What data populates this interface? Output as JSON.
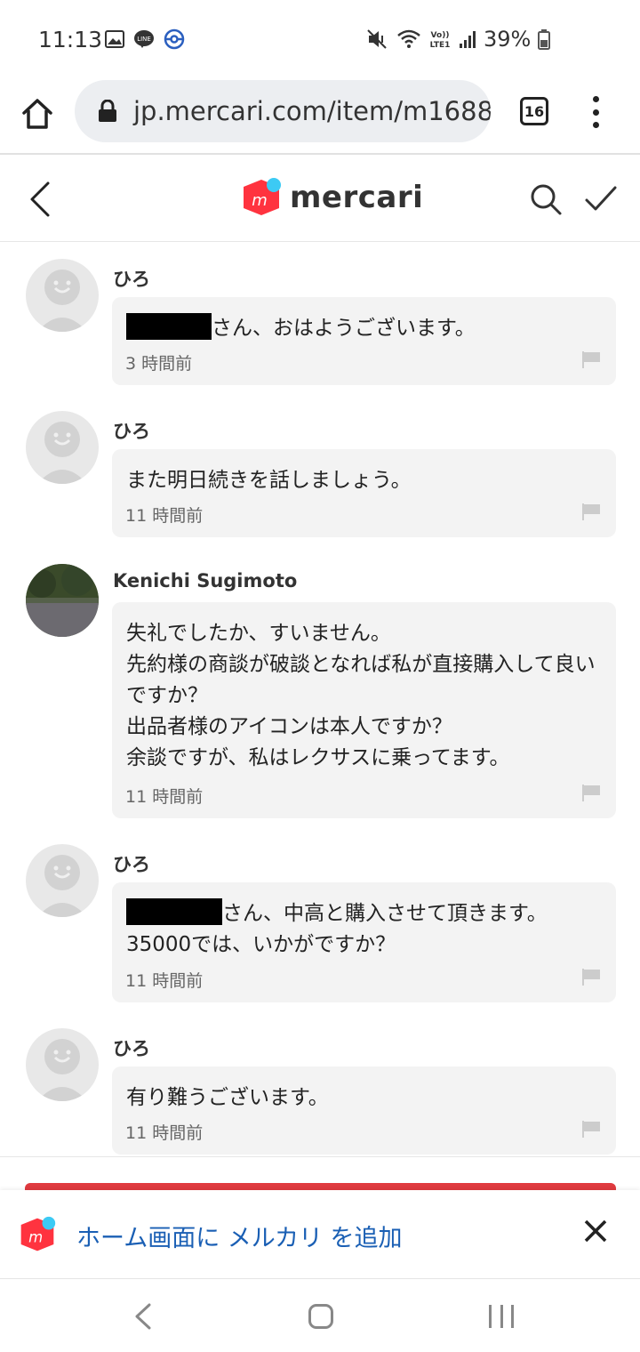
{
  "status_bar": {
    "time": "11:13",
    "battery": "39%",
    "icons": [
      "gallery-icon",
      "line-icon",
      "pokemon-icon",
      "mute-icon",
      "wifi-icon",
      "volte-icon",
      "signal-icon",
      "battery-icon"
    ]
  },
  "browser": {
    "url": "jp.mercari.com/item/m1688",
    "tab_count": "16"
  },
  "header": {
    "brand": "mercari",
    "brand_color": "#ff333f",
    "dot_color": "#3ccaf4"
  },
  "comments": [
    {
      "author": "ひろ",
      "redacted": true,
      "text": "さん、おはようございます。",
      "time": "3 時間前"
    },
    {
      "author": "ひろ",
      "redacted": false,
      "text": "また明日続きを話しましょう。",
      "time": "11 時間前"
    },
    {
      "author": "Kenichi Sugimoto",
      "redacted": false,
      "text": "失礼でしたか、すいません。\n先約様の商談が破談となれば私が直接購入して良いですか？\n出品者様のアイコンは本人ですか？\n余談ですが、私はレクサスに乗ってます。",
      "time": "11 時間前"
    },
    {
      "author": "ひろ",
      "redacted": true,
      "text": "さん、中高と購入させて頂きます。\n35000では、いかがですか？",
      "time": "11 時間前"
    },
    {
      "author": "ひろ",
      "redacted": false,
      "text": "有り難うございます。",
      "time": "11 時間前"
    }
  ],
  "install_banner": {
    "text": "ホーム画面に メルカリ を追加"
  },
  "colors": {
    "buy_button": "#e03a3f",
    "link_blue": "#1a5fb4",
    "bubble_bg": "#f3f3f3"
  }
}
